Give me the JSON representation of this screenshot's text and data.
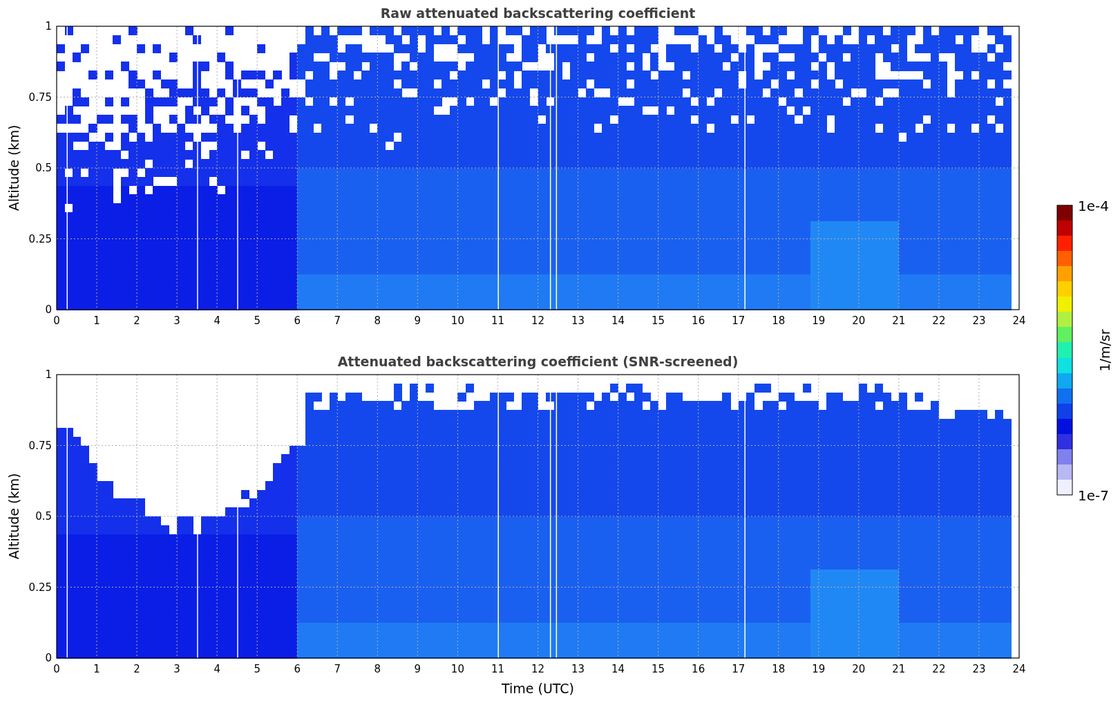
{
  "figure": {
    "panels": [
      {
        "kind": "raw",
        "title": "Raw attenuated backscattering coefficient",
        "ylabel": "Altitude (km)",
        "yticks": [
          "1",
          "0.75",
          "0.5",
          "0.25",
          "0"
        ],
        "xticks": [
          "0",
          "1",
          "2",
          "3",
          "4",
          "5",
          "6",
          "7",
          "8",
          "9",
          "10",
          "11",
          "12",
          "13",
          "14",
          "15",
          "16",
          "17",
          "18",
          "19",
          "20",
          "21",
          "22",
          "23",
          "24"
        ]
      },
      {
        "kind": "screened",
        "title": "Attenuated backscattering coefficient (SNR-screened)",
        "ylabel": "Altitude (km)",
        "yticks": [
          "1",
          "0.75",
          "0.5",
          "0.25",
          "0"
        ],
        "xticks": [
          "0",
          "1",
          "2",
          "3",
          "4",
          "5",
          "6",
          "7",
          "8",
          "9",
          "10",
          "11",
          "12",
          "13",
          "14",
          "15",
          "16",
          "17",
          "18",
          "19",
          "20",
          "21",
          "22",
          "23",
          "24"
        ],
        "xlabel": "Time (UTC)"
      }
    ],
    "colorbar": {
      "top_label": "1e-4",
      "bottom_label": "1e-7",
      "label": "1/m/sr"
    }
  }
}
